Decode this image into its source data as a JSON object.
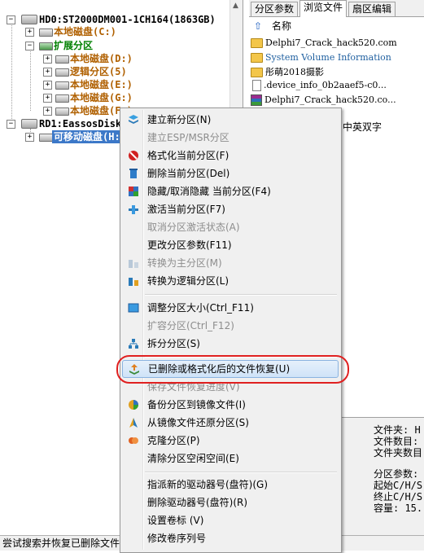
{
  "tree": {
    "disk0": {
      "label": "HD0:ST2000DM001-1CH164(1863GB)"
    },
    "local_c": {
      "label": "本地磁盘(C:)"
    },
    "extended": {
      "label": "扩展分区"
    },
    "local_d": {
      "label": "本地磁盘(D:)"
    },
    "logical5": {
      "label": "逻辑分区(5)"
    },
    "local_e": {
      "label": "本地磁盘(E:)"
    },
    "local_g": {
      "label": "本地磁盘(G:)"
    },
    "local_f": {
      "label": "本地磁盘(F:)"
    },
    "disk1": {
      "label": "RD1:EassosDiskC"
    },
    "removable": {
      "label": "可移动磁盘(H:"
    }
  },
  "tabs": [
    "分区参数",
    "浏览文件",
    "扇区编辑"
  ],
  "file_list": {
    "header": "名称",
    "rows": [
      {
        "name": "Delphi7_Crack_hack520.com",
        "kind": "folder",
        "color": "#000000"
      },
      {
        "name": "System Volume Information",
        "kind": "folder",
        "color": "#2060a0"
      },
      {
        "name": "彤萌2018摄影",
        "kind": "folder",
        "color": "#000000"
      },
      {
        "name": ".device_info_0b2aaef5-c0...",
        "kind": "doc",
        "color": "#000000"
      },
      {
        "name": "Delphi7_Crack_hack520.co...",
        "kind": "rar",
        "color": "#000000"
      }
    ],
    "partial_text": "中英双字"
  },
  "info": {
    "folders": "文件夹: H",
    "file_count": "文件数目:",
    "folder_count": "文件夹数目",
    "part_params": "分区参数:",
    "start": "起始C/H/S",
    "end": "终止C/H/S",
    "capacity": "容量: 15."
  },
  "status": "尝试搜索并恢复已删除文件",
  "menu": {
    "items": [
      {
        "label": "建立新分区(N)",
        "disabled": false,
        "icon": "new-partition-icon"
      },
      {
        "label": "建立ESP/MSR分区",
        "disabled": true,
        "icon": ""
      },
      {
        "label": "格式化当前分区(F)",
        "disabled": false,
        "icon": "format-icon"
      },
      {
        "label": "删除当前分区(Del)",
        "disabled": false,
        "icon": "delete-icon"
      },
      {
        "label": "隐藏/取消隐藏 当前分区(F4)",
        "disabled": false,
        "icon": "hide-icon"
      },
      {
        "label": "激活当前分区(F7)",
        "disabled": false,
        "icon": "activate-icon"
      },
      {
        "label": "取消分区激活状态(A)",
        "disabled": true,
        "icon": ""
      },
      {
        "label": "更改分区参数(F11)",
        "disabled": false,
        "icon": ""
      },
      {
        "label": "转换为主分区(M)",
        "disabled": true,
        "icon": "convert-primary-icon"
      },
      {
        "label": "转换为逻辑分区(L)",
        "disabled": false,
        "icon": "convert-logical-icon"
      },
      {
        "label": "调整分区大小(Ctrl_F11)",
        "disabled": false,
        "icon": "resize-icon"
      },
      {
        "label": "扩容分区(Ctrl_F12)",
        "disabled": true,
        "icon": ""
      },
      {
        "label": "拆分分区(S)",
        "disabled": false,
        "icon": "split-icon"
      },
      {
        "label": "已删除或格式化后的文件恢复(U)",
        "disabled": false,
        "icon": "recover-icon"
      },
      {
        "label": "保存文件恢复进度(V)",
        "disabled": true,
        "icon": ""
      },
      {
        "label": "备份分区到镜像文件(I)",
        "disabled": false,
        "icon": "backup-icon"
      },
      {
        "label": "从镜像文件还原分区(S)",
        "disabled": false,
        "icon": "restore-icon"
      },
      {
        "label": "克隆分区(P)",
        "disabled": false,
        "icon": "clone-icon"
      },
      {
        "label": "清除分区空闲空间(E)",
        "disabled": false,
        "icon": ""
      },
      {
        "label": "指派新的驱动器号(盘符)(G)",
        "disabled": false,
        "icon": ""
      },
      {
        "label": "删除驱动器号(盘符)(R)",
        "disabled": false,
        "icon": ""
      },
      {
        "label": "设置卷标 (V)",
        "disabled": false,
        "icon": ""
      },
      {
        "label": "修改卷序列号",
        "disabled": false,
        "icon": ""
      }
    ]
  },
  "colors": {
    "highlight_ring": "#e02020",
    "tree_brown": "#b06000",
    "tree_green": "#008000",
    "selection": "#3c78c8"
  }
}
